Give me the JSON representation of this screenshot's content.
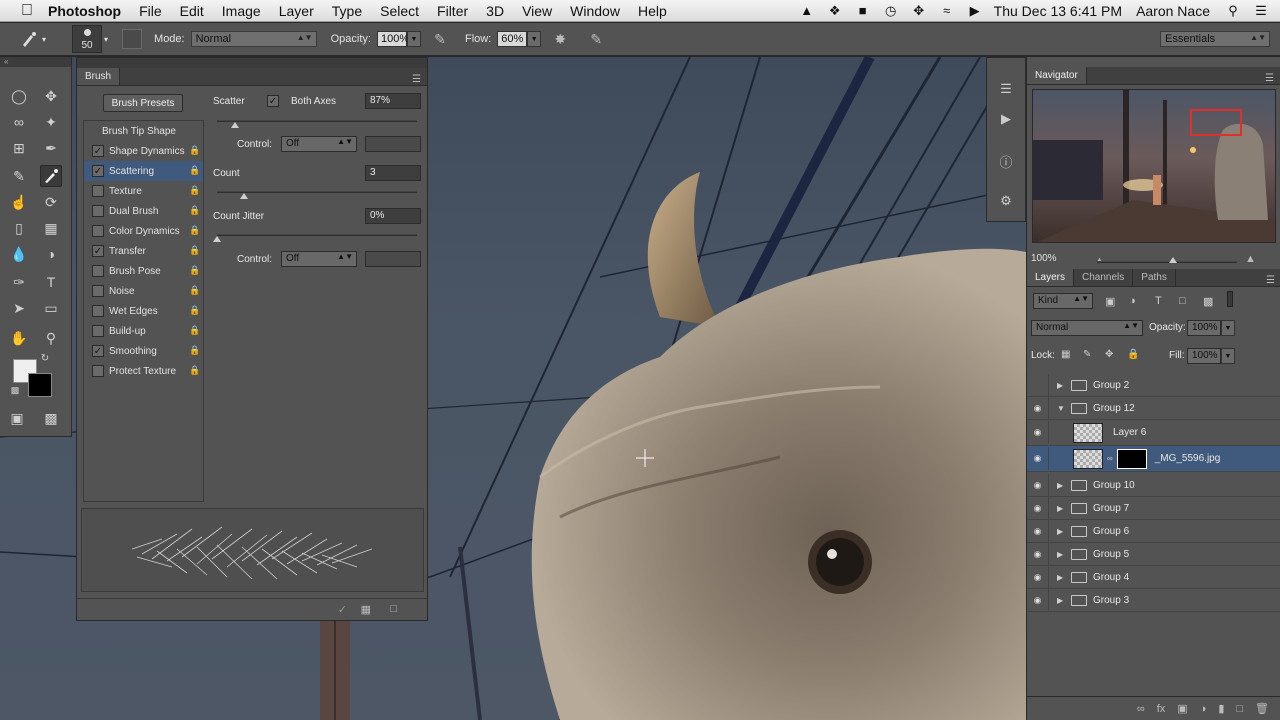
{
  "menubar": {
    "items": [
      "Photoshop",
      "File",
      "Edit",
      "Image",
      "Layer",
      "Type",
      "Select",
      "Filter",
      "3D",
      "View",
      "Window",
      "Help"
    ],
    "clock": "Thu Dec 13  6:41 PM",
    "user": "Aaron Nace"
  },
  "options": {
    "brush_size": "50",
    "mode_label": "Mode:",
    "mode_value": "Normal",
    "opacity_label": "Opacity:",
    "opacity_value": "100%",
    "flow_label": "Flow:",
    "flow_value": "60%",
    "workspace": "Essentials"
  },
  "brush_panel": {
    "tab": "Brush",
    "presets_button": "Brush Presets",
    "tip_shape": "Brush Tip Shape",
    "options": [
      {
        "label": "Shape Dynamics",
        "checked": true,
        "selected": false
      },
      {
        "label": "Scattering",
        "checked": true,
        "selected": true
      },
      {
        "label": "Texture",
        "checked": false,
        "selected": false
      },
      {
        "label": "Dual Brush",
        "checked": false,
        "selected": false
      },
      {
        "label": "Color Dynamics",
        "checked": false,
        "selected": false
      },
      {
        "label": "Transfer",
        "checked": true,
        "selected": false
      },
      {
        "label": "Brush Pose",
        "checked": false,
        "selected": false
      },
      {
        "label": "Noise",
        "checked": false,
        "selected": false
      },
      {
        "label": "Wet Edges",
        "checked": false,
        "selected": false
      },
      {
        "label": "Build-up",
        "checked": false,
        "selected": false
      },
      {
        "label": "Smoothing",
        "checked": true,
        "selected": false
      },
      {
        "label": "Protect Texture",
        "checked": false,
        "selected": false
      }
    ],
    "scatter_label": "Scatter",
    "both_axes_label": "Both Axes",
    "scatter_value": "87%",
    "control_label": "Control:",
    "control_value": "Off",
    "count_label": "Count",
    "count_value": "3",
    "count_jitter_label": "Count Jitter",
    "count_jitter_value": "0%",
    "control2_label": "Control:",
    "control2_value": "Off"
  },
  "navigator": {
    "tab": "Navigator",
    "zoom": "100%"
  },
  "layers_panel": {
    "tabs": [
      "Layers",
      "Channels",
      "Paths"
    ],
    "filter_kind": "Kind",
    "blend_mode": "Normal",
    "opacity_label": "Opacity:",
    "opacity_value": "100%",
    "lock_label": "Lock:",
    "fill_label": "Fill:",
    "fill_value": "100%",
    "layers": [
      {
        "name": "Group 2",
        "type": "group",
        "visible": false,
        "expanded": false
      },
      {
        "name": "Group 12",
        "type": "group",
        "visible": true,
        "expanded": true
      },
      {
        "name": "Layer 6",
        "type": "layer",
        "visible": true
      },
      {
        "name": "_MG_5596.jpg",
        "type": "layer-mask",
        "visible": true,
        "selected": true
      },
      {
        "name": "Group 10",
        "type": "group",
        "visible": true,
        "expanded": false
      },
      {
        "name": "Group 7",
        "type": "group",
        "visible": true,
        "expanded": false
      },
      {
        "name": "Group 6",
        "type": "group",
        "visible": true,
        "expanded": false
      },
      {
        "name": "Group 5",
        "type": "group",
        "visible": true,
        "expanded": false
      },
      {
        "name": "Group 4",
        "type": "group",
        "visible": true,
        "expanded": false
      },
      {
        "name": "Group 3",
        "type": "group",
        "visible": true,
        "expanded": false
      }
    ]
  },
  "colors": {
    "selection": "#3f5a7c",
    "panel": "#535353",
    "nav_box": "#e0302b"
  }
}
